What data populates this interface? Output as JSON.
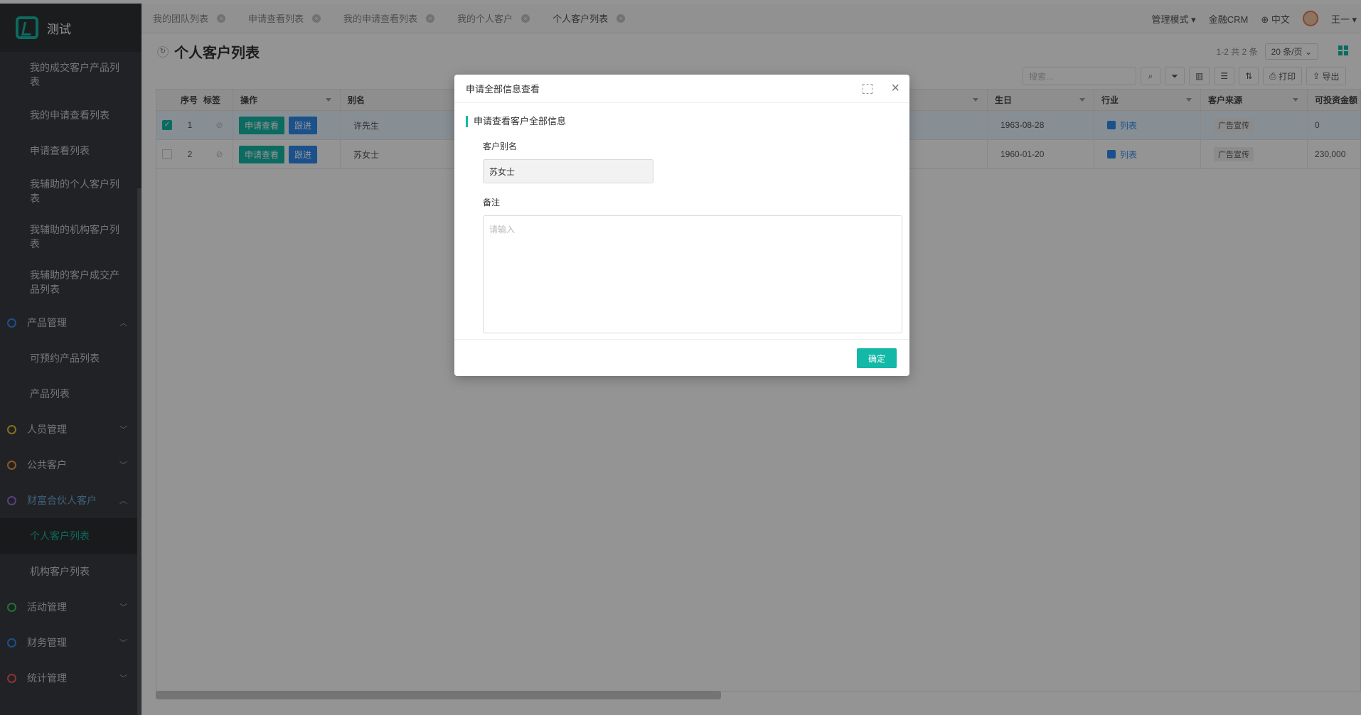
{
  "app": {
    "name": "测试"
  },
  "sidebar": {
    "items": [
      {
        "label": "我的成交客户产品列表"
      },
      {
        "label": "我的申请查看列表"
      },
      {
        "label": "申请查看列表"
      },
      {
        "label": "我辅助的个人客户列表"
      },
      {
        "label": "我辅助的机构客户列表"
      },
      {
        "label": "我辅助的客户成交产品列表"
      }
    ],
    "groups": [
      {
        "label": "产品管理",
        "color": "#2d8cf0"
      },
      {
        "label": "人员管理",
        "color": "#e0c531"
      },
      {
        "label": "公共客户",
        "color": "#f0983c"
      },
      {
        "label": "财富合伙人客户",
        "color": "#9b6cd6"
      },
      {
        "label": "活动管理",
        "color": "#34c759"
      },
      {
        "label": "财务管理",
        "color": "#2d8cf0"
      },
      {
        "label": "统计管理",
        "color": "#f05a5a"
      }
    ],
    "product_sub": [
      {
        "label": "可预约产品列表"
      },
      {
        "label": "产品列表"
      }
    ],
    "wealth_sub": [
      {
        "label": "个人客户列表"
      },
      {
        "label": "机构客户列表"
      }
    ]
  },
  "tabs": [
    {
      "label": "我的团队列表"
    },
    {
      "label": "申请查看列表"
    },
    {
      "label": "我的申请查看列表"
    },
    {
      "label": "我的个人客户"
    },
    {
      "label": "个人客户列表"
    }
  ],
  "top_right": {
    "mode": "管理模式",
    "crm": "金融CRM",
    "lang": "中文",
    "user": "王一"
  },
  "page": {
    "title": "个人客户列表",
    "pager_info": "1-2 共 2 条",
    "page_size": "20 条/页"
  },
  "toolbar": {
    "search_placeholder": "搜索...",
    "print": "打印",
    "export": "导出"
  },
  "table": {
    "headers": {
      "index": "序号",
      "tag": "标签",
      "action": "操作",
      "alias": "别名",
      "birthday": "生日",
      "industry": "行业",
      "source": "客户来源",
      "investable": "可投资金额"
    },
    "rows": [
      {
        "index": "1",
        "alias": "许先生",
        "birthday": "1963-08-28",
        "industry": "列表",
        "source": "广告宣传",
        "investable": "0",
        "checked": true
      },
      {
        "index": "2",
        "alias": "苏女士",
        "birthday": "1960-01-20",
        "industry": "列表",
        "source": "广告宣传",
        "investable": "230,000",
        "checked": false
      }
    ],
    "btn_apply": "申请查看",
    "btn_follow": "跟进"
  },
  "modal": {
    "title": "申请全部信息查看",
    "section": "申请查看客户全部信息",
    "alias_label": "客户别名",
    "alias_value": "苏女士",
    "remark_label": "备注",
    "remark_placeholder": "请输入",
    "ok": "确定"
  }
}
